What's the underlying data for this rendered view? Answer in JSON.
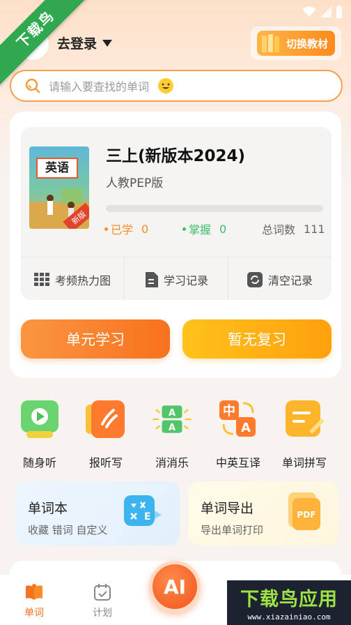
{
  "ribbon": {
    "text": "下载鸟"
  },
  "header": {
    "login_label": "去登录",
    "switch_label": "切换教材"
  },
  "search": {
    "placeholder": "请输入要查找的单词"
  },
  "book": {
    "cover_title": "英语",
    "cover_tag": "新版",
    "title": "三上(新版本2024)",
    "edition": "人教PEP版",
    "progress": 0,
    "learned_label": "已学",
    "learned_value": "0",
    "mastered_label": "掌握",
    "mastered_value": "0",
    "total_label": "总词数",
    "total_value": "111"
  },
  "tools": [
    {
      "label": "考频热力图"
    },
    {
      "label": "学习记录"
    },
    {
      "label": "清空记录"
    }
  ],
  "actions": {
    "unit_study": "单元学习",
    "no_review": "暂无复习"
  },
  "features": [
    {
      "label": "随身听",
      "icon": "play-icon"
    },
    {
      "label": "报听写",
      "icon": "dictation-icon"
    },
    {
      "label": "消消乐",
      "icon": "match-game-icon"
    },
    {
      "label": "中英互译",
      "icon": "translate-icon"
    },
    {
      "label": "单词拼写",
      "icon": "spelling-icon"
    }
  ],
  "cards": {
    "wordbook": {
      "title": "单词本",
      "subtitle": "收藏 错词 自定义"
    },
    "export": {
      "title": "单词导出",
      "subtitle": "导出单词打印"
    }
  },
  "tabbar": {
    "words": "单词",
    "plan": "计划",
    "ai": "AI"
  },
  "watermark": {
    "main": "下载鸟应用",
    "sub": "www.xiazainiao.com"
  },
  "colors": {
    "accent": "#f7721e",
    "review": "#ffa00e",
    "learned": "#f98c2a",
    "mastered": "#3cc06b"
  }
}
